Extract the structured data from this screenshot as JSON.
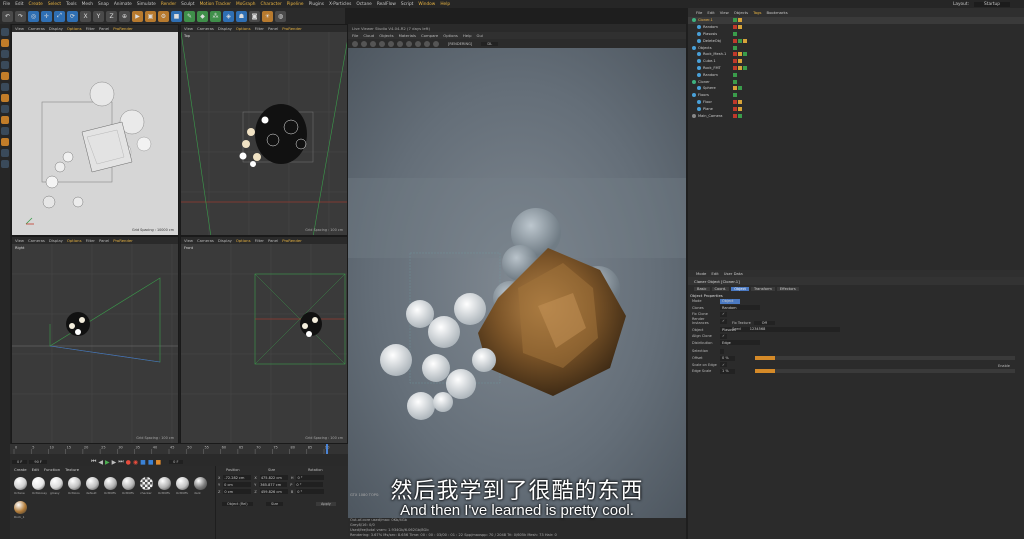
{
  "menubar": {
    "items": [
      "File",
      "Edit",
      "Create",
      "Select",
      "Tools",
      "Mesh",
      "Snap",
      "Animate",
      "Simulate",
      "Render",
      "Sculpt",
      "Motion Tracker",
      "MoGraph",
      "Character",
      "Pipeline",
      "Plugins",
      "X-Particles",
      "Octane",
      "RealFlow",
      "Script",
      "Window",
      "Help"
    ],
    "highlighted": [
      "Create",
      "Select",
      "Render",
      "Motion Tracker",
      "MoGraph",
      "Character",
      "Pipeline",
      "Window",
      "Help"
    ],
    "layout_label": "Layout:",
    "layout_value": "Startup"
  },
  "toolbar": {
    "axis_x": "X",
    "axis_y": "Y",
    "axis_z": "Z"
  },
  "viewports": {
    "menu": [
      "View",
      "Cameras",
      "Display",
      "Options",
      "Filter",
      "Panel",
      "ProRender"
    ],
    "highlighted_menu": "Options",
    "top_left": {
      "label": "",
      "grid": "Grid Spacing : 10000 cm"
    },
    "top_right": {
      "label": "Top",
      "grid": "Grid Spacing : 100 cm"
    },
    "bottom_left": {
      "label": "Right",
      "grid": "Grid Spacing : 100 cm"
    },
    "bottom_right": {
      "label": "Front",
      "grid": "Grid Spacing : 100 cm"
    }
  },
  "live_viewer": {
    "title": "Live Viewer Studio V4.04-R2 (7 days left)",
    "menu": [
      "File",
      "Cloud",
      "Objects",
      "Materials",
      "Compare",
      "Options",
      "Help",
      "Gui"
    ],
    "render_status": "[RENDERING]",
    "dropdown": "DL",
    "status_lines": [
      "Out-of-core used/max: 0Kb/4Gb",
      "Grey8/16: 0/0",
      "Used/fee/total vram: 1.934Gb/6.062Gb/8Gb",
      "Rendering: 3.67%  Ms/sec: 8.656  Time: 00 : 00 : 03/00 : 01 : 22  Spp/maxspp: 70 / 2048  Tri: 0/605k  Mesh: 73  Hair: 0"
    ],
    "gtx_label": "GTX 1080 TOPS:"
  },
  "object_manager": {
    "menu": [
      "File",
      "Edit",
      "View",
      "Objects",
      "Tags",
      "Bookmarks"
    ],
    "rows": [
      {
        "name": "Cloner.1",
        "indent": 0,
        "selected": true
      },
      {
        "name": "Random",
        "indent": 1,
        "selected": false
      },
      {
        "name": "Plasosis",
        "indent": 1,
        "selected": false
      },
      {
        "name": "DeleteObj",
        "indent": 1,
        "selected": false
      },
      {
        "name": "Objects",
        "indent": 0,
        "selected": false
      },
      {
        "name": "Rock_Mesh.1",
        "indent": 1,
        "selected": false
      },
      {
        "name": "Cube.1",
        "indent": 1,
        "selected": false
      },
      {
        "name": "Rock_FMT",
        "indent": 1,
        "selected": false
      },
      {
        "name": "Random",
        "indent": 1,
        "selected": false
      },
      {
        "name": "Cloner",
        "indent": 0,
        "selected": false
      },
      {
        "name": "Sphere",
        "indent": 1,
        "selected": false
      },
      {
        "name": "Floors",
        "indent": 0,
        "selected": false
      },
      {
        "name": "Floor",
        "indent": 1,
        "selected": false
      },
      {
        "name": "Plane",
        "indent": 1,
        "selected": false
      },
      {
        "name": "Main_Camera",
        "indent": 0,
        "selected": false
      }
    ]
  },
  "attributes": {
    "menu": [
      "Mode",
      "Edit",
      "User Data"
    ],
    "title": "Cloner Object [Cloner.1]",
    "tabs": [
      "Basic",
      "Coord.",
      "Object",
      "Transform",
      "Effectors"
    ],
    "active_tab": "Object",
    "section": "Object Properties",
    "rows": [
      {
        "label": "Mode",
        "value": "Object"
      },
      {
        "label": "Clones",
        "value": "Random"
      },
      {
        "label": "Fix Clone",
        "value": "✓"
      },
      {
        "label": "Render Instances",
        "value": "✓"
      },
      {
        "label": "Object",
        "value": "Plasosis"
      },
      {
        "label": "Align Clone",
        "value": "✓"
      },
      {
        "label": "Distribution",
        "value": "Edge"
      },
      {
        "label": "Selection",
        "value": ""
      },
      {
        "label": "Offset",
        "value": "0 %"
      },
      {
        "label": "Scale on Edge",
        "value": "✓"
      },
      {
        "label": "Edge Scale",
        "value": "1 %"
      }
    ],
    "fix_texture_label": "Fix Texture",
    "fix_texture_value": "Off",
    "seed_label": "Seed",
    "seed_value": "1234568",
    "enable_label": "Enable"
  },
  "timeline": {
    "ticks": [
      "0",
      "5",
      "10",
      "15",
      "20",
      "25",
      "30",
      "35",
      "40",
      "45",
      "50",
      "55",
      "60",
      "65",
      "70",
      "75",
      "80",
      "85",
      "90"
    ],
    "start": "0 F",
    "current": "90 F",
    "end": "0 F"
  },
  "material_manager": {
    "menu": [
      "Create",
      "Edit",
      "Function",
      "Texture"
    ],
    "materials": [
      {
        "label": "Octane",
        "color": "#cfcfcf"
      },
      {
        "label": "OctGlossy",
        "color": "#e6e6e6"
      },
      {
        "label": "glossy",
        "color": "#d8d8d8"
      },
      {
        "label": "OctGlos",
        "color": "#c0c0c0"
      },
      {
        "label": "default",
        "color": "#bebebe"
      },
      {
        "label": "OctDiffu",
        "color": "#b3b3b3"
      },
      {
        "label": "OctDiffu",
        "color": "#b6b6b6"
      },
      {
        "label": "checker",
        "color": "#9a9a9a"
      },
      {
        "label": "OctDiffu",
        "color": "#b1b1b1"
      },
      {
        "label": "OctDiffu",
        "color": "#c2c2c2"
      },
      {
        "label": "dark",
        "color": "#7a7a7a"
      },
      {
        "label": "Rock_1",
        "color": "#b07a37"
      }
    ],
    "material_accent": "#b07a37"
  },
  "coordinates": {
    "headers": [
      "Position",
      "Size",
      "Rotation"
    ],
    "rows": [
      {
        "axis": "X",
        "pos": "-72.282 cm",
        "size": "475.822 cm",
        "rot_axis": "H",
        "rot": "0 °"
      },
      {
        "axis": "Y",
        "pos": "0 cm",
        "size": "365.877 cm",
        "rot_axis": "P",
        "rot": "0 °"
      },
      {
        "axis": "Z",
        "pos": "0 cm",
        "size": "459.826 cm",
        "rot_axis": "B",
        "rot": "0 °"
      }
    ],
    "mode": "Object (Rel)",
    "size_mode": "Size",
    "apply": "Apply"
  },
  "subtitles": {
    "chinese": "然后我学到了很酷的东西",
    "english": "And then I've learned is pretty cool."
  }
}
